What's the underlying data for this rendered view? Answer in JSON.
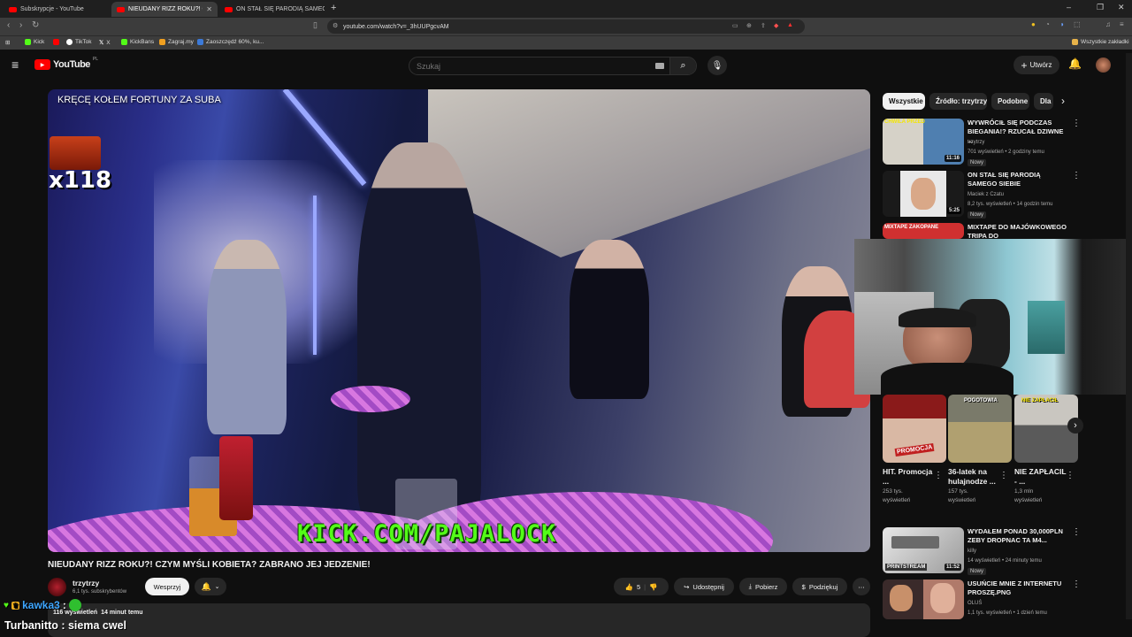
{
  "browser": {
    "tabs": [
      {
        "label": "Subskrypcje - YouTube",
        "active": false
      },
      {
        "label": "NIEUDANY RIZZ ROKU?! CZY",
        "active": true
      },
      {
        "label": "ON STAŁ SIĘ PARODIĄ SAMEGO SIEBIE",
        "active": false
      }
    ],
    "new_tab": "+",
    "url": "youtube.com/watch?v=_3hUUPgcvAM",
    "bookmarks": [
      {
        "label": "Kick",
        "color": "#53fc18"
      },
      {
        "label": "",
        "color": "#ff0000"
      },
      {
        "label": "TikTok",
        "color": "#ffffff"
      },
      {
        "label": "X",
        "color": "#ffffff"
      },
      {
        "label": "KickBans",
        "color": "#53fc18"
      },
      {
        "label": "Zagraj.my",
        "color": "#f0a020"
      },
      {
        "label": "Zaoszczędź 60%, ku...",
        "color": "#3c7ad8"
      }
    ],
    "all_bookmarks": "Wszystkie zakładki"
  },
  "youtube": {
    "logo": "YouTube",
    "region": "PL",
    "search_placeholder": "Szukaj",
    "create_label": "Utwórz",
    "brand_color": "#ff0000"
  },
  "video": {
    "overlay_top": "KRĘCĘ KOŁEM FORTUNY ZA SUBA",
    "overlay_count": "x118",
    "overlay_link": "KICK.COM/PAJALOCK",
    "title": "NIEUDANY RIZZ ROKU?! CZYM MYŚLI KOBIETA? ZABRANO JEJ JEDZENIE!",
    "channel": "trzytrzy",
    "subscribers": "6,1 tys. subskrybentów",
    "support_label": "Wesprzyj",
    "likes": "5",
    "share_label": "Udostępnij",
    "download_label": "Pobierz",
    "thanks_label": "Podziękuj",
    "views": "116 wyświetleń",
    "uploaded": "14 minut temu"
  },
  "chips": [
    "Wszystkie",
    "Źródło: trzytrzy",
    "Podobne",
    "Dla"
  ],
  "recommendations": [
    {
      "title": "WYWRÓCIŁ SIĘ PODCZAS BIEGANIA!? RZUCAŁ DZIWNE ...",
      "channel": "trzytrzy",
      "meta": "701 wyświetleń • 2 godziny temu",
      "badge": "Nowy",
      "duration": "11:16"
    },
    {
      "title": "ON STAŁ SIĘ PARODIĄ SAMEGO SIEBIE",
      "channel": "Maciek z Czatu",
      "meta": "8,2 tys. wyświetleń • 14 godzin temu",
      "badge": "Nowy",
      "duration": "5:25"
    },
    {
      "title": "MIXTAPE DO MAJÓWKOWEGO TRIPA DO",
      "channel": "",
      "meta": "",
      "badge": "",
      "duration": ""
    }
  ],
  "shorts": [
    {
      "title": "HIT. Promocja ...",
      "views": "253 tys.",
      "views2": "wyświetleń",
      "thumb_text": "PROMOCJA"
    },
    {
      "title": "36-latek na hulajnodze ...",
      "views": "157 tys.",
      "views2": "wyświetleń",
      "thumb_text": "POGOTOWIA"
    },
    {
      "title": "NIE ZAPŁACIL - ...",
      "views": "1,3 mln",
      "views2": "wyświetleń",
      "thumb_text": "NIE ZAPŁACIŁ"
    }
  ],
  "recommendations2": [
    {
      "title": "WYDAŁEM PONAD 30,000PLN ZEBY DROPNAC TA M4...",
      "channel": "killy",
      "meta": "14 wyświetleń • 24 minuty temu",
      "badge": "Nowy",
      "duration": "11:52",
      "thumb_text": "PRINTSTREAM"
    },
    {
      "title": "USUŃCIE MNIE Z INTERNETU PROSZĘ.PNG",
      "channel": "OLUŚ",
      "meta": "1,1 tys. wyświetleń • 1 dzień temu",
      "badge": "",
      "duration": "",
      "thumb_text": ""
    }
  ],
  "chat": [
    {
      "user": "kawka3",
      "message": "",
      "color": "#3ea6ff"
    },
    {
      "user": "Turbanitto",
      "message": "siema cwel",
      "color": "#ffffff"
    }
  ]
}
